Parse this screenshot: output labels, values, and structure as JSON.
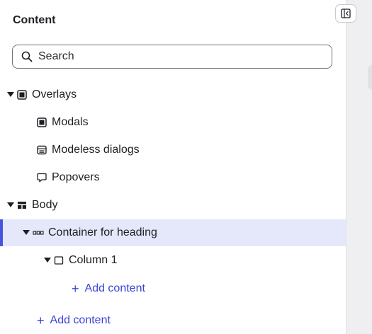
{
  "panel": {
    "title": "Content",
    "search": {
      "placeholder": "Search",
      "value": ""
    }
  },
  "tree": {
    "overlays": {
      "label": "Overlays",
      "icon": "overlay-icon"
    },
    "modals": {
      "label": "Modals",
      "icon": "modal-icon"
    },
    "modeless": {
      "label": "Modeless dialogs",
      "icon": "modeless-dialog-icon"
    },
    "popovers": {
      "label": "Popovers",
      "icon": "popover-icon"
    },
    "body": {
      "label": "Body",
      "icon": "body-layout-icon"
    },
    "container": {
      "label": "Container for heading",
      "icon": "container-icon",
      "selected": true
    },
    "column": {
      "label": "Column 1",
      "icon": "column-icon"
    },
    "add_in_column": {
      "label": "Add content"
    },
    "add_in_body": {
      "label": "Add content"
    }
  },
  "colors": {
    "accent": "#4a52e0",
    "selected_bg": "#e5e7fb",
    "link": "#3845d6"
  }
}
